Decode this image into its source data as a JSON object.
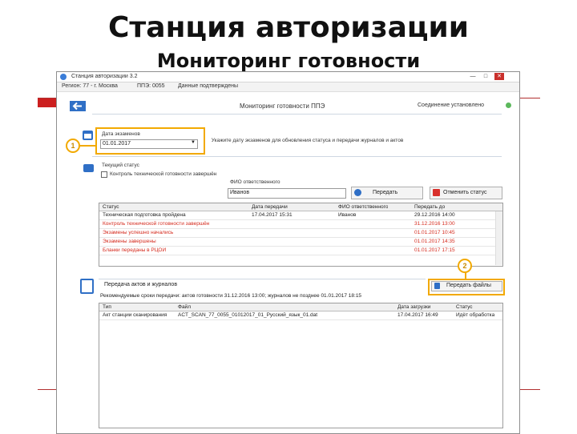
{
  "slide": {
    "title": "Станция авторизации",
    "subtitle": "Мониторинг готовности"
  },
  "window": {
    "title": "Станция авторизации 3.2",
    "controls": {
      "minimize": "—",
      "maximize": "□",
      "close": "✕"
    }
  },
  "infobar": {
    "region": "Регион: 77 - г. Москва",
    "ppe": "ППЭ: 0055",
    "status": "Данные подтверждены"
  },
  "screen": {
    "title": "Мониторинг готовности ППЭ",
    "connection": "Соединение установлено"
  },
  "exam_date": {
    "label": "Дата экзаменов",
    "value": "01.01.2017",
    "hint": "Укажите дату экзаменов для обновления статуса и передачи журналов и актов"
  },
  "current_status": {
    "label": "Текущий статус",
    "checkbox_label": "Контроль технической готовности завершён",
    "fio_label": "ФИО ответственного",
    "fio_value": "Иванов",
    "send_button": "Передать",
    "cancel_button": "Отменить статус"
  },
  "status_table": {
    "columns": [
      "Статус",
      "Дата передачи",
      "ФИО ответственного",
      "Передать до"
    ],
    "rows": [
      {
        "status": "Техническая подготовка пройдена",
        "sent": "17.04.2017 15:31",
        "fio": "Иванов",
        "due": "29.12.2016 14:00",
        "highlight": false
      },
      {
        "status": "Контроль технической готовности завершён",
        "sent": "",
        "fio": "",
        "due": "31.12.2016 13:00",
        "highlight": true
      },
      {
        "status": "Экзамены успешно начались",
        "sent": "",
        "fio": "",
        "due": "01.01.2017 10:45",
        "highlight": true
      },
      {
        "status": "Экзамены завершены",
        "sent": "",
        "fio": "",
        "due": "01.01.2017 14:35",
        "highlight": true
      },
      {
        "status": "Бланки переданы в РЦОИ",
        "sent": "",
        "fio": "",
        "due": "01.01.2017 17:15",
        "highlight": true
      }
    ]
  },
  "markers": {
    "one": "1",
    "two": "2"
  },
  "acts": {
    "label": "Передача актов и журналов",
    "note": "Рекомендуемые сроки передачи: актов готовности 31.12.2016 13:00; журналов не позднее 01.01.2017 18:15",
    "upload_button": "Передать файлы",
    "columns": [
      "Тип",
      "Файл",
      "Дата загрузки",
      "Статус"
    ],
    "rows": [
      {
        "type": "Акт станции сканирования",
        "file": "ACT_SCAN_77_0055_01012017_01_Русский_язык_01.dat",
        "date": "17.04.2017 16:49",
        "status": "Идёт обработка"
      }
    ]
  },
  "colors": {
    "accent": "#2f6fc6",
    "highlight": "#f2a900",
    "error": "#d52b1e",
    "ok": "#5cb85c",
    "slide_decor": "#cc1f1f"
  }
}
